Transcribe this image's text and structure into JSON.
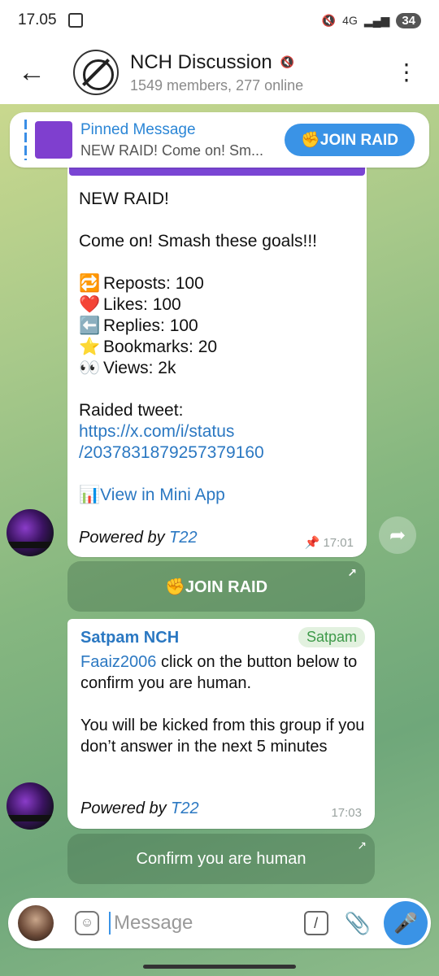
{
  "status": {
    "time": "17.05",
    "net": "4G",
    "battery": "34"
  },
  "header": {
    "title": "NCH Discussion",
    "subtitle": "1549 members, 277 online"
  },
  "pinned": {
    "title": "Pinned Message",
    "preview": "NEW RAID!  Come on! Sm...",
    "button": "✊JOIN RAID"
  },
  "msg1": {
    "line1": "NEW RAID!",
    "line2": "Come on! Smash these goals!!!",
    "stats": [
      {
        "icon": "🔁",
        "text": "Reposts: 100"
      },
      {
        "icon": "❤️",
        "text": "Likes: 100"
      },
      {
        "icon": "⬅️",
        "text": "Replies: 100"
      },
      {
        "icon": "⭐",
        "text": "Bookmarks: 20"
      },
      {
        "icon": "👀",
        "text": "Views: 2k"
      }
    ],
    "raided_label": "Raided tweet:",
    "url1": "https://x.com/i/status",
    "url2": "/2037831879257379160",
    "miniapp_icon": "📊",
    "miniapp": "View in Mini App",
    "powered_prefix": "Powered by ",
    "powered_link": "T22",
    "time": "17:01",
    "button": "✊JOIN RAID"
  },
  "msg2": {
    "sender": "Satpam NCH",
    "tag": "Satpam",
    "mention": "Faaiz2006",
    "text1": " click on the button below to confirm you are human.",
    "text2": "You will be kicked from this group if you don’t answer in the next 5 minutes",
    "powered_prefix": "Powered by ",
    "powered_link": "T22",
    "time": "17:03",
    "button": "Confirm you are human"
  },
  "composer": {
    "placeholder": "Message"
  }
}
